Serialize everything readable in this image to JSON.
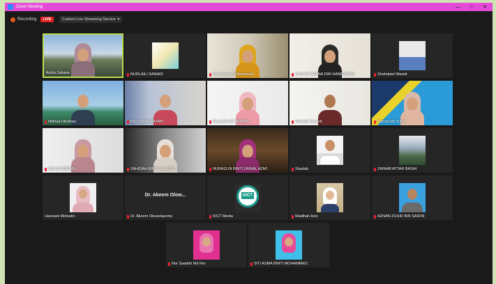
{
  "window": {
    "title": "Zoom Meeting",
    "minimize": "—",
    "maximize": "□",
    "close": "✕"
  },
  "toolbar": {
    "recording_label": "Recording",
    "live_label": "LIVE",
    "stream_label": "Custom Live Streaming Service",
    "stream_caret": "▾"
  },
  "participants": [
    {
      "name": "Azida Zakaria"
    },
    {
      "name": "NURLAILI SANADI"
    },
    {
      "name": "Nurulhana Bt Mohamad"
    },
    {
      "name": "D.IN OKTARINA DWI HANDAYANI"
    },
    {
      "name": "Shahdatul Wasidi"
    },
    {
      "name": "Nhihad Hinshaw"
    },
    {
      "name": "KICT AMIR AATAM"
    },
    {
      "name": "Rasyidah BT AHMAD"
    },
    {
      "name": "Hamaid Yaacob"
    },
    {
      "name": "Nurcia Md Yusof"
    },
    {
      "name": "AZLIN NORDIN"
    },
    {
      "name": "ZAHIDAH BINTI ZULKIFLI"
    },
    {
      "name": "NURAZLIN BINTI ZAINAL AZMI"
    },
    {
      "name": "Shadab"
    },
    {
      "name": "ZAINAB ATTAR BASHI"
    },
    {
      "name": "Hazwani Mohadin"
    },
    {
      "name": "Dr. Akeem Olowolayemo",
      "display_text": "Dr. Akeem Olow..."
    },
    {
      "name": "KICT Media"
    },
    {
      "name": "Madihah Aziz"
    },
    {
      "name": "AZNAN ZUHID BIN SAIDIN"
    },
    {
      "name": "Nor Saadah Md Nor"
    },
    {
      "name": "SITI ASMA BINTI MOHAMMED"
    }
  ],
  "colors": {
    "titlebar": "#e44bd6",
    "active_border": "#b9e04a",
    "live_badge": "#e02020",
    "muted_mic": "#e22233"
  }
}
